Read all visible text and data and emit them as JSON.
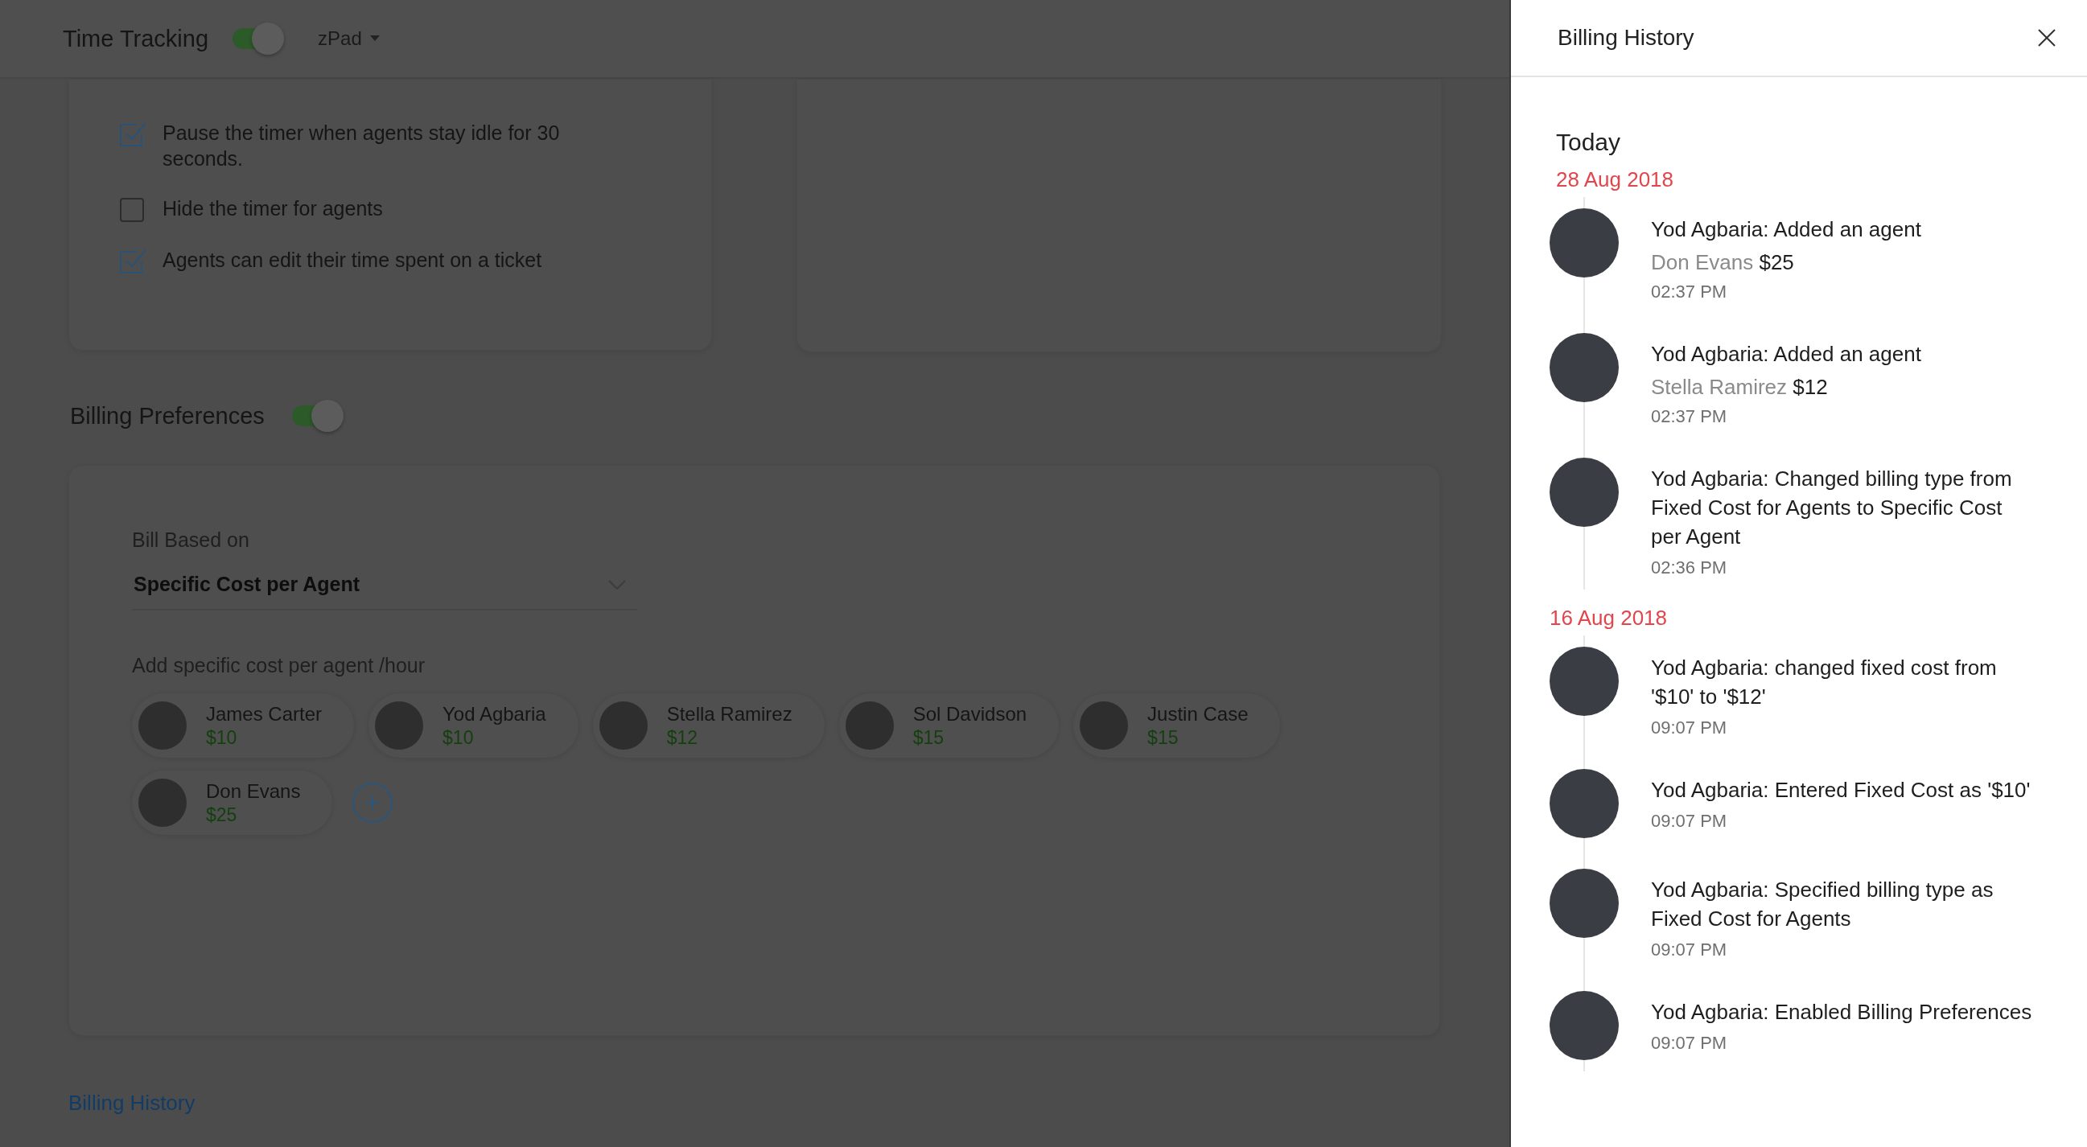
{
  "header": {
    "title": "Time Tracking",
    "toggle_on": true,
    "dropdown": "zPad"
  },
  "time_tracking_options": [
    {
      "label": "Pause the timer when agents stay idle for 30 seconds.",
      "checked": true
    },
    {
      "label": "Hide the timer for agents",
      "checked": false
    },
    {
      "label": "Agents can edit their time spent on a ticket",
      "checked": true
    }
  ],
  "billing": {
    "title": "Billing Preferences",
    "toggle_on": true,
    "bill_based_label": "Bill Based on",
    "bill_based_value": "Specific Cost per Agent",
    "cost_label": "Add specific cost per agent /hour",
    "agents": [
      {
        "name": "James Carter",
        "cost": "$10"
      },
      {
        "name": "Yod Agbaria",
        "cost": "$10"
      },
      {
        "name": "Stella Ramirez",
        "cost": "$12"
      },
      {
        "name": "Sol Davidson",
        "cost": "$15"
      },
      {
        "name": "Justin Case",
        "cost": "$15"
      },
      {
        "name": "Don Evans",
        "cost": "$25"
      }
    ]
  },
  "billing_history_link": "Billing History",
  "panel": {
    "title": "Billing History",
    "today_label": "Today",
    "groups": [
      {
        "date": "28 Aug 2018",
        "entries": [
          {
            "text": "Yod Agbaria: Added an agent",
            "agent": "Don Evans",
            "cost": "$25",
            "time": "02:37 PM"
          },
          {
            "text": "Yod Agbaria: Added an agent",
            "agent": "Stella Ramirez",
            "cost": "$12",
            "time": "02:37 PM"
          },
          {
            "text": "Yod Agbaria: Changed billing type from Fixed Cost for Agents to Specific Cost per Agent",
            "time": "02:36 PM"
          }
        ]
      },
      {
        "date": "16 Aug 2018",
        "entries": [
          {
            "text": "Yod Agbaria: changed fixed cost from '$10' to '$12'",
            "time": "09:07 PM"
          },
          {
            "text": "Yod Agbaria: Entered Fixed Cost as '$10'",
            "time": "09:07 PM"
          },
          {
            "text": "Yod Agbaria: Specified billing type as Fixed Cost for Agents",
            "time": "09:07 PM"
          },
          {
            "text": "Yod Agbaria: Enabled Billing Preferences",
            "time": "09:07 PM"
          }
        ]
      }
    ]
  }
}
